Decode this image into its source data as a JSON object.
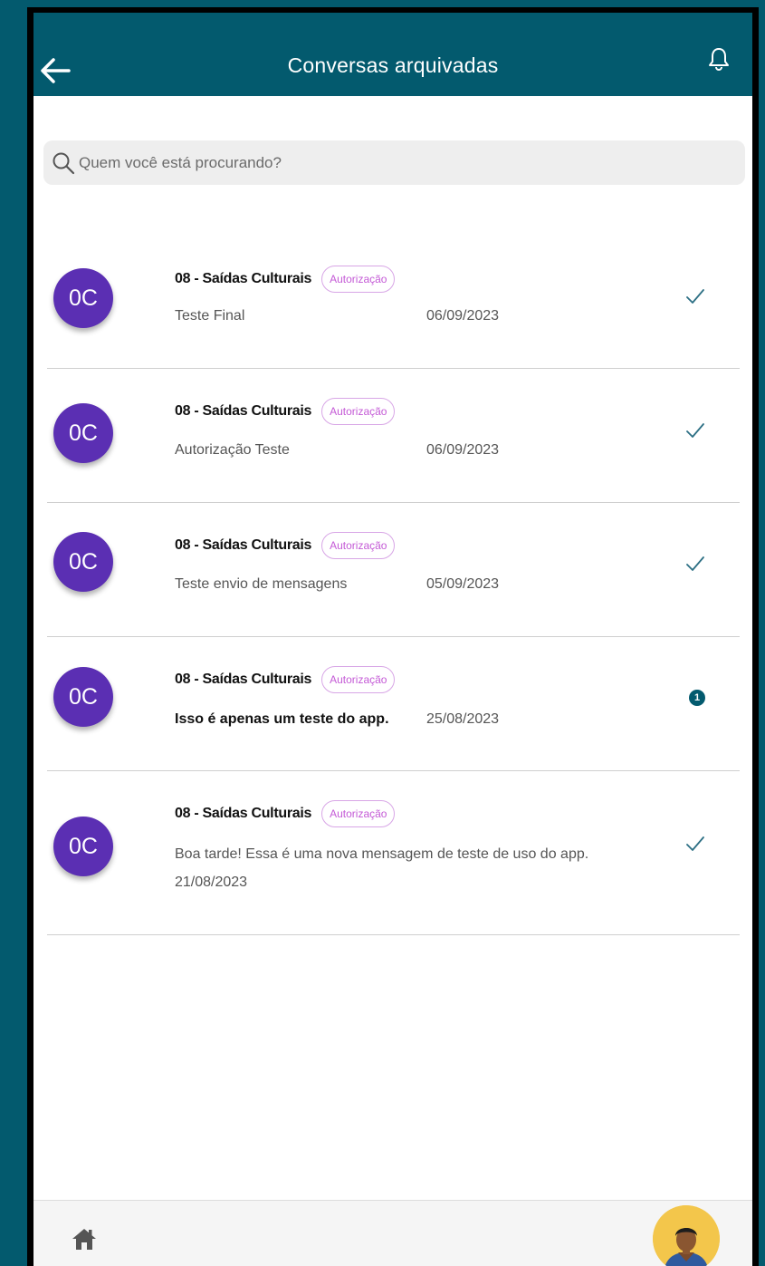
{
  "header": {
    "title": "Conversas arquivadas",
    "back_icon": "arrow-left-icon",
    "bell_icon": "bell-icon"
  },
  "search": {
    "placeholder": "Quem você está procurando?",
    "icon": "search-icon"
  },
  "conversations": [
    {
      "initials": "0C",
      "title": "08 - Saídas Culturais",
      "tag": "Autorização",
      "message": "Teste Final",
      "date": "06/09/2023",
      "status": "read"
    },
    {
      "initials": "0C",
      "title": "08 - Saídas Culturais",
      "tag": "Autorização",
      "message": "Autorização Teste",
      "date": "06/09/2023",
      "status": "read"
    },
    {
      "initials": "0C",
      "title": "08 - Saídas Culturais",
      "tag": "Autorização",
      "message": "Teste envio de mensagens",
      "date": "05/09/2023",
      "status": "read"
    },
    {
      "initials": "0C",
      "title": "08 - Saídas Culturais",
      "tag": "Autorização",
      "message": "Isso é apenas um teste do app.",
      "date": "25/08/2023",
      "status": "unread",
      "unread_count": "1"
    },
    {
      "initials": "0C",
      "title": "08 - Saídas Culturais",
      "tag": "Autorização",
      "message": "Boa tarde! Essa é uma nova mensagem de teste de uso do app.",
      "date": "21/08/2023",
      "status": "read"
    }
  ],
  "bottom_nav": {
    "home_icon": "home-icon",
    "profile_icon": "profile-avatar"
  },
  "colors": {
    "primary": "#035a6e",
    "avatar": "#5b2fb3",
    "tag": "#c45ad6"
  }
}
